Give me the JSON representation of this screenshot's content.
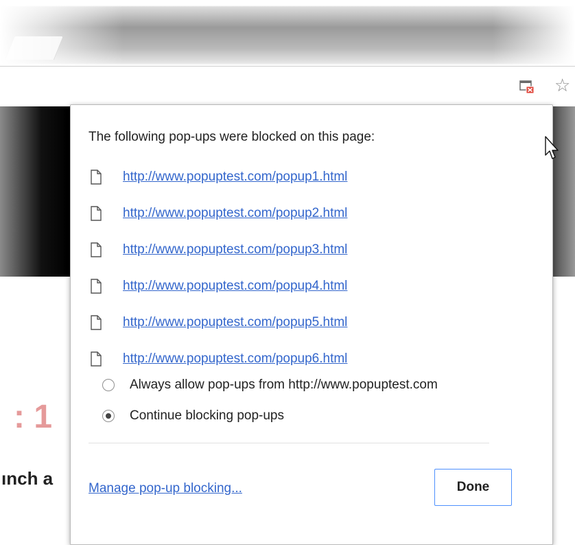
{
  "popup": {
    "title": "The following pop-ups were blocked on this page:",
    "links": [
      "http://www.popuptest.com/popup1.html",
      "http://www.popuptest.com/popup2.html",
      "http://www.popuptest.com/popup3.html",
      "http://www.popuptest.com/popup4.html",
      "http://www.popuptest.com/popup5.html",
      "http://www.popuptest.com/popup6.html"
    ],
    "options": [
      {
        "label": "Always allow pop-ups from http://www.popuptest.com",
        "selected": false
      },
      {
        "label": "Continue blocking pop-ups",
        "selected": true
      }
    ],
    "manage_label": "Manage pop-up blocking...",
    "done_label": "Done"
  },
  "background": {
    "heading_fragment": ": 1",
    "text_fragment": "ınch a"
  },
  "icons": {
    "toolbar": [
      "popup-blocked-icon",
      "star-icon"
    ],
    "list": "document-icon",
    "pointer": "mouse-cursor-icon"
  },
  "colors": {
    "link": "#3366cc",
    "done_border": "#4d90fe",
    "blocked_badge": "#e0463b",
    "bg_heading": "#e59a9a"
  }
}
